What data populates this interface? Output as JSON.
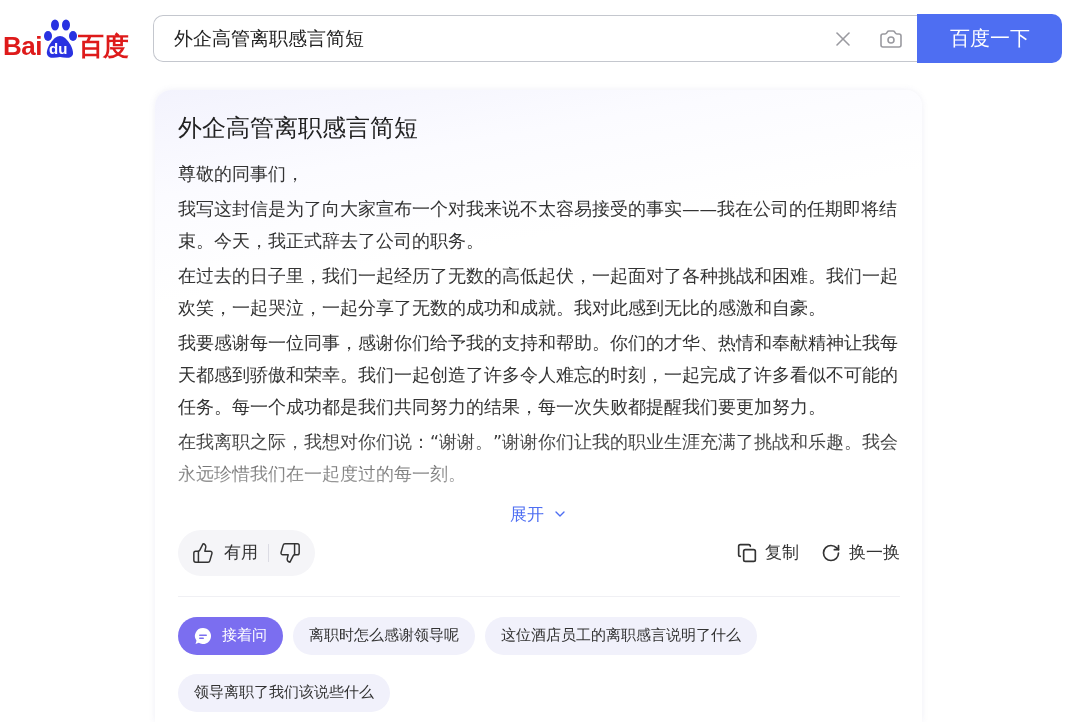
{
  "logo": {
    "parts": [
      "Bai",
      "du",
      "百度"
    ]
  },
  "search": {
    "value": "外企高管离职感言简短",
    "button": "百度一下"
  },
  "answer": {
    "title": "外企高管离职感言简短",
    "paragraphs": [
      "尊敬的同事们，",
      "我写这封信是为了向大家宣布一个对我来说不太容易接受的事实——我在公司的任期即将结束。今天，我正式辞去了公司的职务。",
      "在过去的日子里，我们一起经历了无数的高低起伏，一起面对了各种挑战和困难。我们一起欢笑，一起哭泣，一起分享了无数的成功和成就。我对此感到无比的感激和自豪。",
      "我要感谢每一位同事，感谢你们给予我的支持和帮助。你们的才华、热情和奉献精神让我每天都感到骄傲和荣幸。我们一起创造了许多令人难忘的时刻，一起完成了许多看似不可能的任务。每一个成功都是我们共同努力的结果，每一次失败都提醒我们要更加努力。",
      "在我离职之际，我想对你们说：“谢谢。”谢谢你们让我的职业生涯充满了挑战和乐趣。我会永远珍惜我们在一起度过的每一刻。"
    ],
    "expand": "展开",
    "feedback": {
      "useful": "有用"
    },
    "actions": [
      {
        "kind": "copy",
        "label": "复制"
      },
      {
        "kind": "refresh",
        "label": "换一换"
      }
    ]
  },
  "follow_up": {
    "label": "接着问",
    "suggestions": [
      "离职时怎么感谢领导呢",
      "这位酒店员工的离职感言说明了什么",
      "领导离职了我们该说些什么"
    ]
  }
}
